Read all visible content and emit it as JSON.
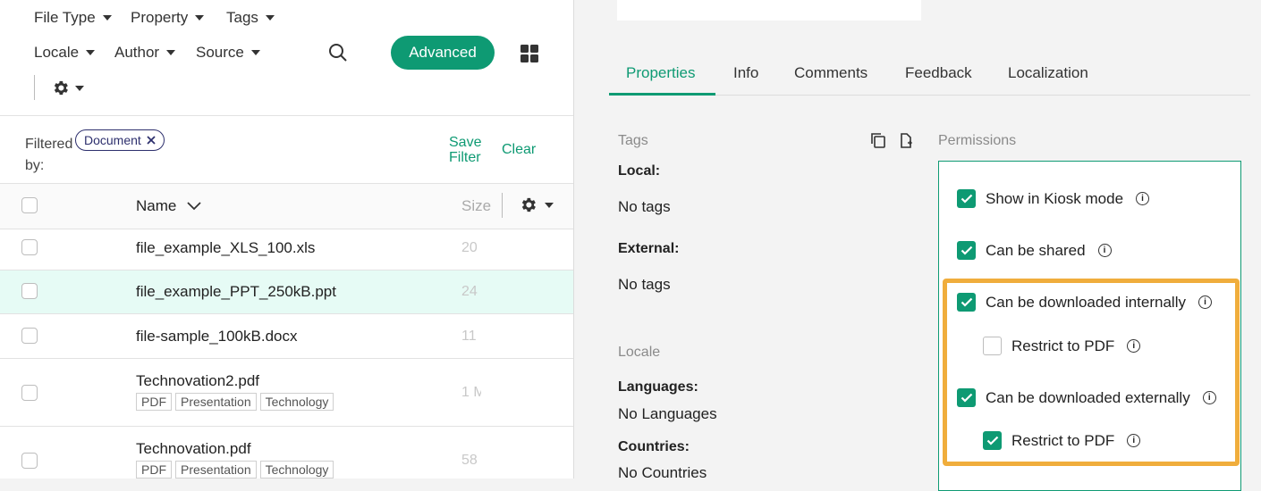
{
  "filters": {
    "row1": [
      "File Type",
      "Property",
      "Tags"
    ],
    "row2": [
      "Locale",
      "Author",
      "Source"
    ],
    "advanced_label": "Advanced"
  },
  "filtered": {
    "label_line1": "Filtered",
    "label_line2": "by:",
    "chip_label": "Document",
    "save_line1": "Save",
    "save_line2": "Filter",
    "clear_label": "Clear"
  },
  "table": {
    "columns": {
      "name": "Name",
      "size": "Size"
    },
    "rows": [
      {
        "name": "file_example_XLS_100.xls",
        "size": "20",
        "tags": []
      },
      {
        "name": "file_example_PPT_250kB.ppt",
        "size": "24",
        "tags": []
      },
      {
        "name": "file-sample_100kB.docx",
        "size": "11",
        "tags": []
      },
      {
        "name": "Technovation2.pdf",
        "size": "1 M",
        "tags": [
          "PDF",
          "Presentation",
          "Technology"
        ]
      },
      {
        "name": "Technovation.pdf",
        "size": "58",
        "tags": [
          "PDF",
          "Presentation",
          "Technology"
        ]
      }
    ]
  },
  "tabs": [
    "Properties",
    "Info",
    "Comments",
    "Feedback",
    "Localization"
  ],
  "details": {
    "tags_heading": "Tags",
    "local_label": "Local:",
    "local_value": "No tags",
    "external_label": "External:",
    "external_value": "No tags",
    "locale_heading": "Locale",
    "languages_label": "Languages:",
    "languages_value": "No Languages",
    "countries_label": "Countries:",
    "countries_value": "No Countries"
  },
  "permissions": {
    "heading": "Permissions",
    "items": [
      {
        "label": "Show in Kiosk mode",
        "checked": true
      },
      {
        "label": "Can be shared",
        "checked": true
      },
      {
        "label": "Can be downloaded internally",
        "checked": true
      },
      {
        "label": "Restrict to PDF",
        "checked": false
      },
      {
        "label": "Can be downloaded externally",
        "checked": true
      },
      {
        "label": "Restrict to PDF",
        "checked": true
      }
    ]
  },
  "colors": {
    "accent": "#0e9a73",
    "highlight": "#f0ad3c",
    "chip": "#2d2f6d",
    "selected_row": "#e6fbf5"
  },
  "icons": [
    "search-icon",
    "grid-view-icon",
    "gear-icon",
    "chevron-down-icon",
    "close-icon",
    "copy-icon",
    "paste-icon",
    "info-icon",
    "check-icon"
  ]
}
